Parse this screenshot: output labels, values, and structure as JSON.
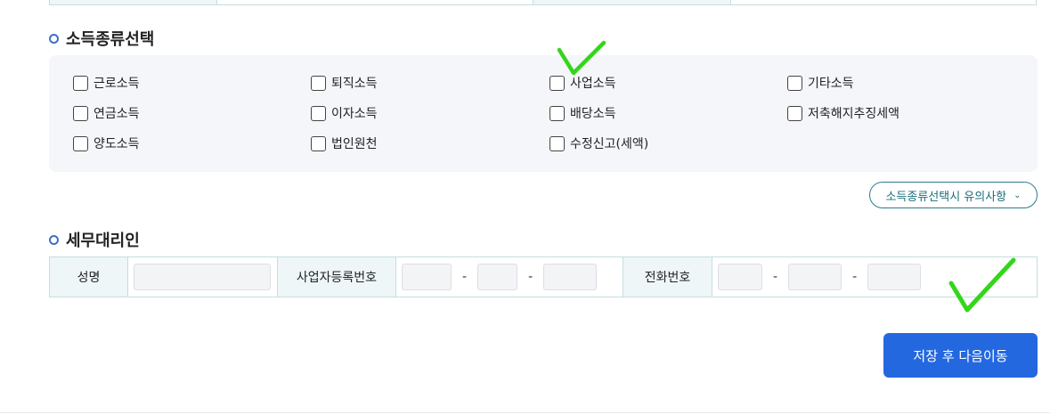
{
  "income_section": {
    "title": "소득종류선택",
    "options": [
      [
        "근로소득",
        "퇴직소득",
        "사업소득",
        "기타소득"
      ],
      [
        "연금소득",
        "이자소득",
        "배당소득",
        "저축해지추징세액"
      ],
      [
        "양도소득",
        "법인원천",
        "수정신고(세액)"
      ]
    ],
    "notice_label": "소득종류선택시 유의사항"
  },
  "agent_section": {
    "title": "세무대리인",
    "name_label": "성명",
    "bizno_label": "사업자등록번호",
    "phone_label": "전화번호",
    "separator": "-"
  },
  "footer": {
    "save_next_label": "저장 후 다음이동"
  },
  "colors": {
    "primary": "#2468e0",
    "annotation_check": "#33d61a",
    "panel_bg": "#f4f6fa"
  }
}
